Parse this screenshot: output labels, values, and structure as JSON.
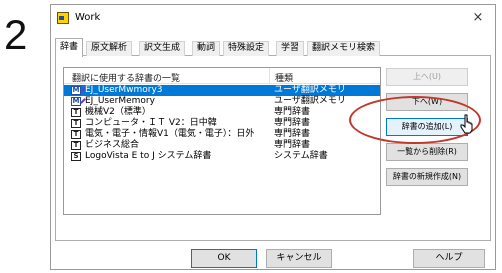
{
  "step_number": "2",
  "window": {
    "title": "Work",
    "close_glyph": "×"
  },
  "tabs": [
    {
      "label": "辞書"
    },
    {
      "label": "原文解析"
    },
    {
      "label": "訳文生成"
    },
    {
      "label": "動詞"
    },
    {
      "label": "特殊設定"
    },
    {
      "label": "学習"
    },
    {
      "label": "翻訳メモリ検索"
    }
  ],
  "active_tab": "辞書",
  "list": {
    "header_name": "翻訳に使用する辞書の一覧",
    "header_type": "種類",
    "rows": [
      {
        "icon": "user-memory-icon",
        "icon_glyph": "M",
        "name": "EJ_UserMwmory3",
        "type": "ユーザ翻訳メモリ",
        "selected": true
      },
      {
        "icon": "user-memory-icon",
        "icon_glyph": "M",
        "name": "EJ_UserMemory",
        "type": "ユーザ翻訳メモリ",
        "selected": false
      },
      {
        "icon": "dictionary-icon",
        "icon_glyph": "T",
        "name": "機械V2（標準）",
        "type": "専門辞書",
        "selected": false
      },
      {
        "icon": "dictionary-icon",
        "icon_glyph": "T",
        "name": "コンピュータ・ＩＴ V2：日中韓",
        "type": "専門辞書",
        "selected": false
      },
      {
        "icon": "dictionary-icon",
        "icon_glyph": "T",
        "name": "電気・電子・情報V1（電気・電子）：日外",
        "type": "専門辞書",
        "selected": false
      },
      {
        "icon": "dictionary-icon",
        "icon_glyph": "T",
        "name": "ビジネス総合",
        "type": "専門辞書",
        "selected": false
      },
      {
        "icon": "system-dictionary-icon",
        "icon_glyph": "S",
        "name": "LogoVista E to J システム辞書",
        "type": "システム辞書",
        "selected": false
      }
    ]
  },
  "side_buttons": {
    "up": "上へ(U)",
    "down": "下へ(W)",
    "add": "辞書の追加(L)",
    "remove": "一覧から削除(R)",
    "new": "辞書の新規作成(N)"
  },
  "bottom_buttons": {
    "ok": "OK",
    "cancel": "キャンセル",
    "help": "ヘルプ"
  },
  "colors": {
    "selection": "#0078d7",
    "annotation_ellipse": "#c0392b"
  }
}
